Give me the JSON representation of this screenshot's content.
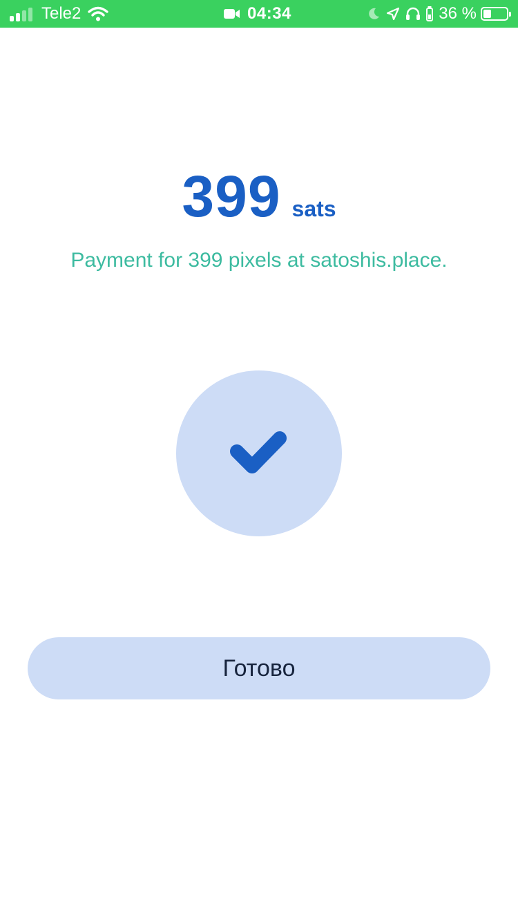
{
  "status_bar": {
    "carrier": "Tele2",
    "time": "04:34",
    "battery_percent": "36 %",
    "icons": [
      "cellular-signal-icon",
      "wifi-icon",
      "video-camera-icon",
      "moon-icon",
      "location-arrow-icon",
      "headphones-icon",
      "charging-indicator-icon",
      "battery-icon"
    ],
    "background_color": "#3ad15f"
  },
  "payment": {
    "amount": "399",
    "unit": "sats",
    "memo": "Payment for 399 pixels at satoshis.place."
  },
  "success_icon": "checkmark-icon",
  "done_button": {
    "label": "Готово"
  },
  "colors": {
    "accent_blue": "#1a5fc4",
    "memo_teal": "#3dbba0",
    "light_blue": "#cddcf6",
    "button_text": "#17243d"
  }
}
